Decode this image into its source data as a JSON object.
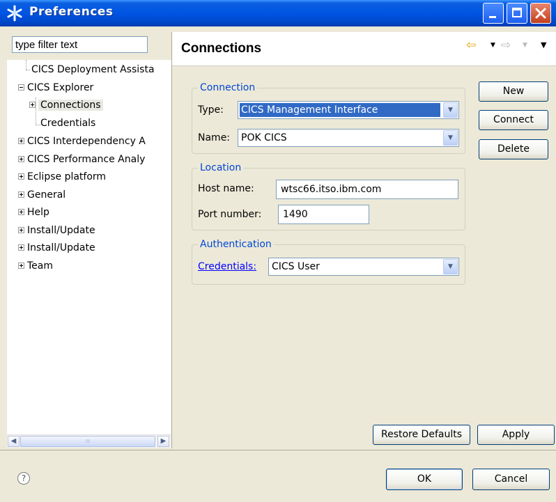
{
  "window": {
    "title": "Preferences",
    "colors": {
      "titlebar": "#0054e3",
      "accent": "#0046d5",
      "selection": "#316ac5"
    }
  },
  "sidebar": {
    "filter_placeholder": "type filter text",
    "items": [
      {
        "label": "CICS Deployment Assista",
        "expander": "none"
      },
      {
        "label": "CICS Explorer",
        "expander": "minus"
      },
      {
        "label": "Connections",
        "expander": "plus",
        "selected": true
      },
      {
        "label": "Credentials",
        "expander": "none"
      },
      {
        "label": "CICS Interdependency A",
        "expander": "plus"
      },
      {
        "label": "CICS Performance Analy",
        "expander": "plus"
      },
      {
        "label": "Eclipse platform",
        "expander": "plus"
      },
      {
        "label": "General",
        "expander": "plus"
      },
      {
        "label": "Help",
        "expander": "plus"
      },
      {
        "label": "Install/Update",
        "expander": "plus"
      },
      {
        "label": "Install/Update",
        "expander": "plus"
      },
      {
        "label": "Team",
        "expander": "plus"
      }
    ],
    "scroll_thumb_glyph": "III"
  },
  "page": {
    "title": "Connections",
    "connection_group": {
      "legend": "Connection",
      "type_label": "Type:",
      "type_value": "CICS Management Interface",
      "name_label": "Name:",
      "name_value": "POK CICS"
    },
    "location_group": {
      "legend": "Location",
      "host_label": "Host name:",
      "host_value": "wtsc66.itso.ibm.com",
      "port_label": "Port number:",
      "port_value": "1490"
    },
    "auth_group": {
      "legend": "Authentication",
      "credentials_link": "Credentials:",
      "credentials_value": "CICS User"
    },
    "buttons": {
      "new": "New",
      "connect": "Connect",
      "delete": "Delete",
      "restore_defaults": "Restore Defaults",
      "apply": "Apply"
    }
  },
  "footer": {
    "ok": "OK",
    "cancel": "Cancel",
    "help_glyph": "?"
  },
  "icons": {
    "app": "asterisk-icon",
    "back": "back-arrow-icon",
    "forward": "forward-arrow-icon",
    "menu": "view-menu-icon",
    "help": "help-icon"
  }
}
